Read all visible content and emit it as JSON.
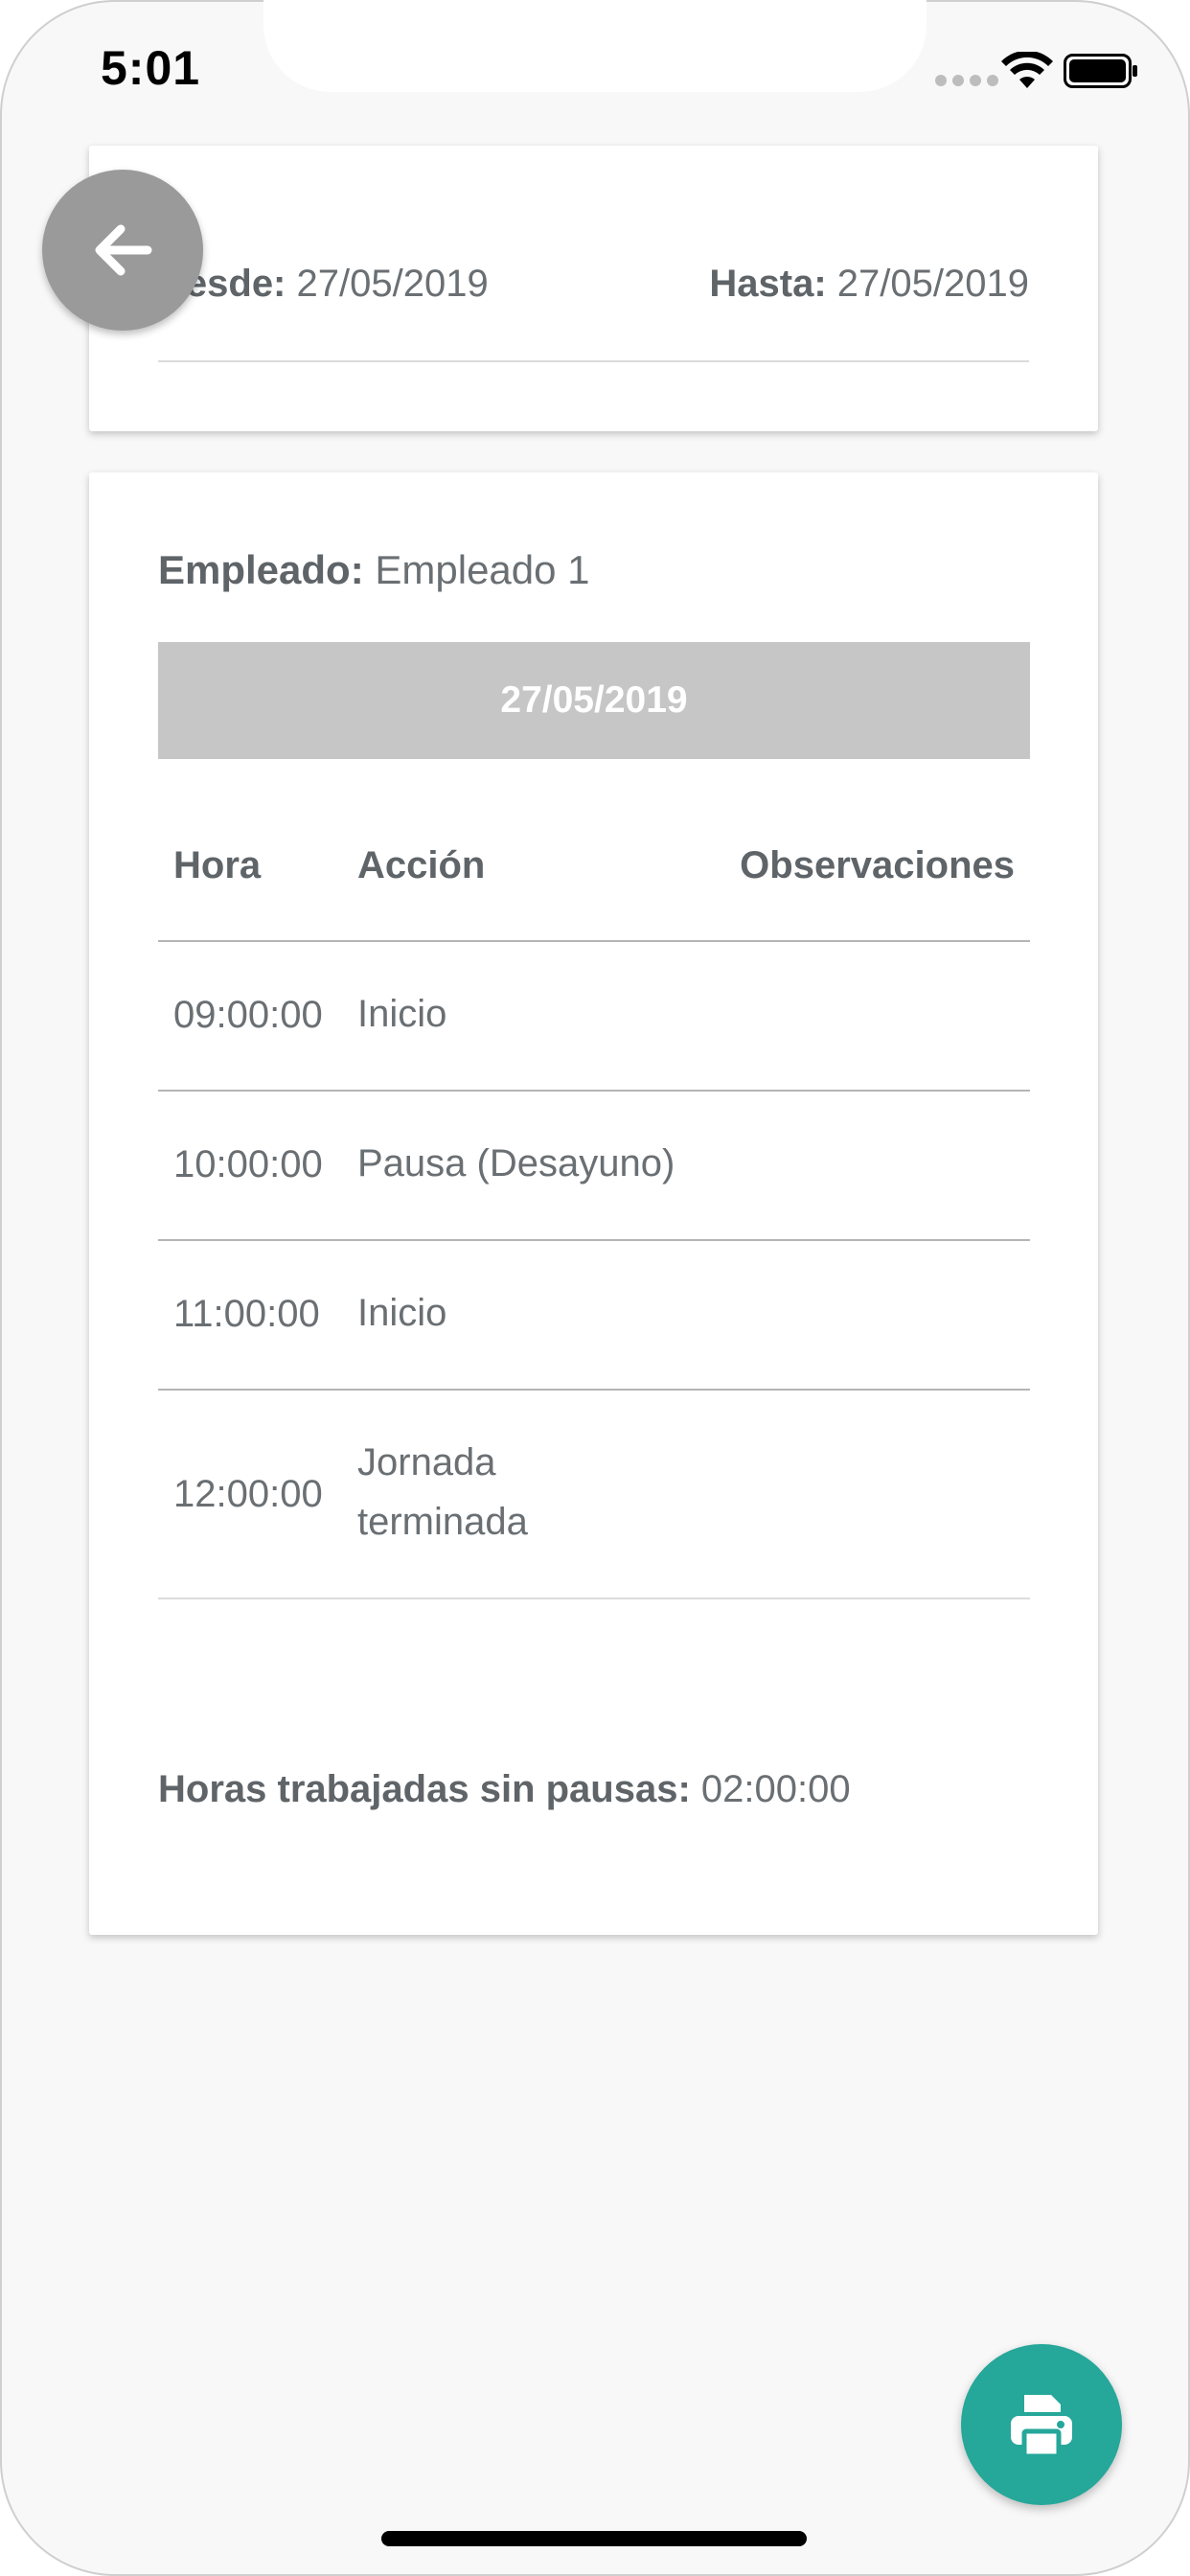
{
  "status_bar": {
    "time": "5:01"
  },
  "dates_card": {
    "desde_label": "Desde:",
    "desde_value": "27/05/2019",
    "hasta_label": "Hasta:",
    "hasta_value": "27/05/2019"
  },
  "report_card": {
    "employee_label": "Empleado:",
    "employee_value": "Empleado 1",
    "date_header": "27/05/2019",
    "table": {
      "headers": {
        "hora": "Hora",
        "accion": "Acción",
        "observaciones": "Observaciones"
      },
      "rows": [
        {
          "hora": "09:00:00",
          "accion": "Inicio",
          "observaciones": ""
        },
        {
          "hora": "10:00:00",
          "accion": "Pausa (Desayuno)",
          "observaciones": ""
        },
        {
          "hora": "11:00:00",
          "accion": "Inicio",
          "observaciones": ""
        },
        {
          "hora": "12:00:00",
          "accion_line1": "Jornada",
          "accion_line2": "terminada",
          "observaciones": ""
        }
      ]
    },
    "summary_label": "Horas trabajadas sin pausas:",
    "summary_value": "02:00:00"
  },
  "icons": {
    "back": "arrow-left-icon",
    "print": "printer-icon"
  },
  "colors": {
    "background": "#f8f8f8",
    "date_bar": "#c6c6c6",
    "back_button": "#9a9a9a",
    "print_button": "#25a79a",
    "text": "#6a6f73"
  }
}
